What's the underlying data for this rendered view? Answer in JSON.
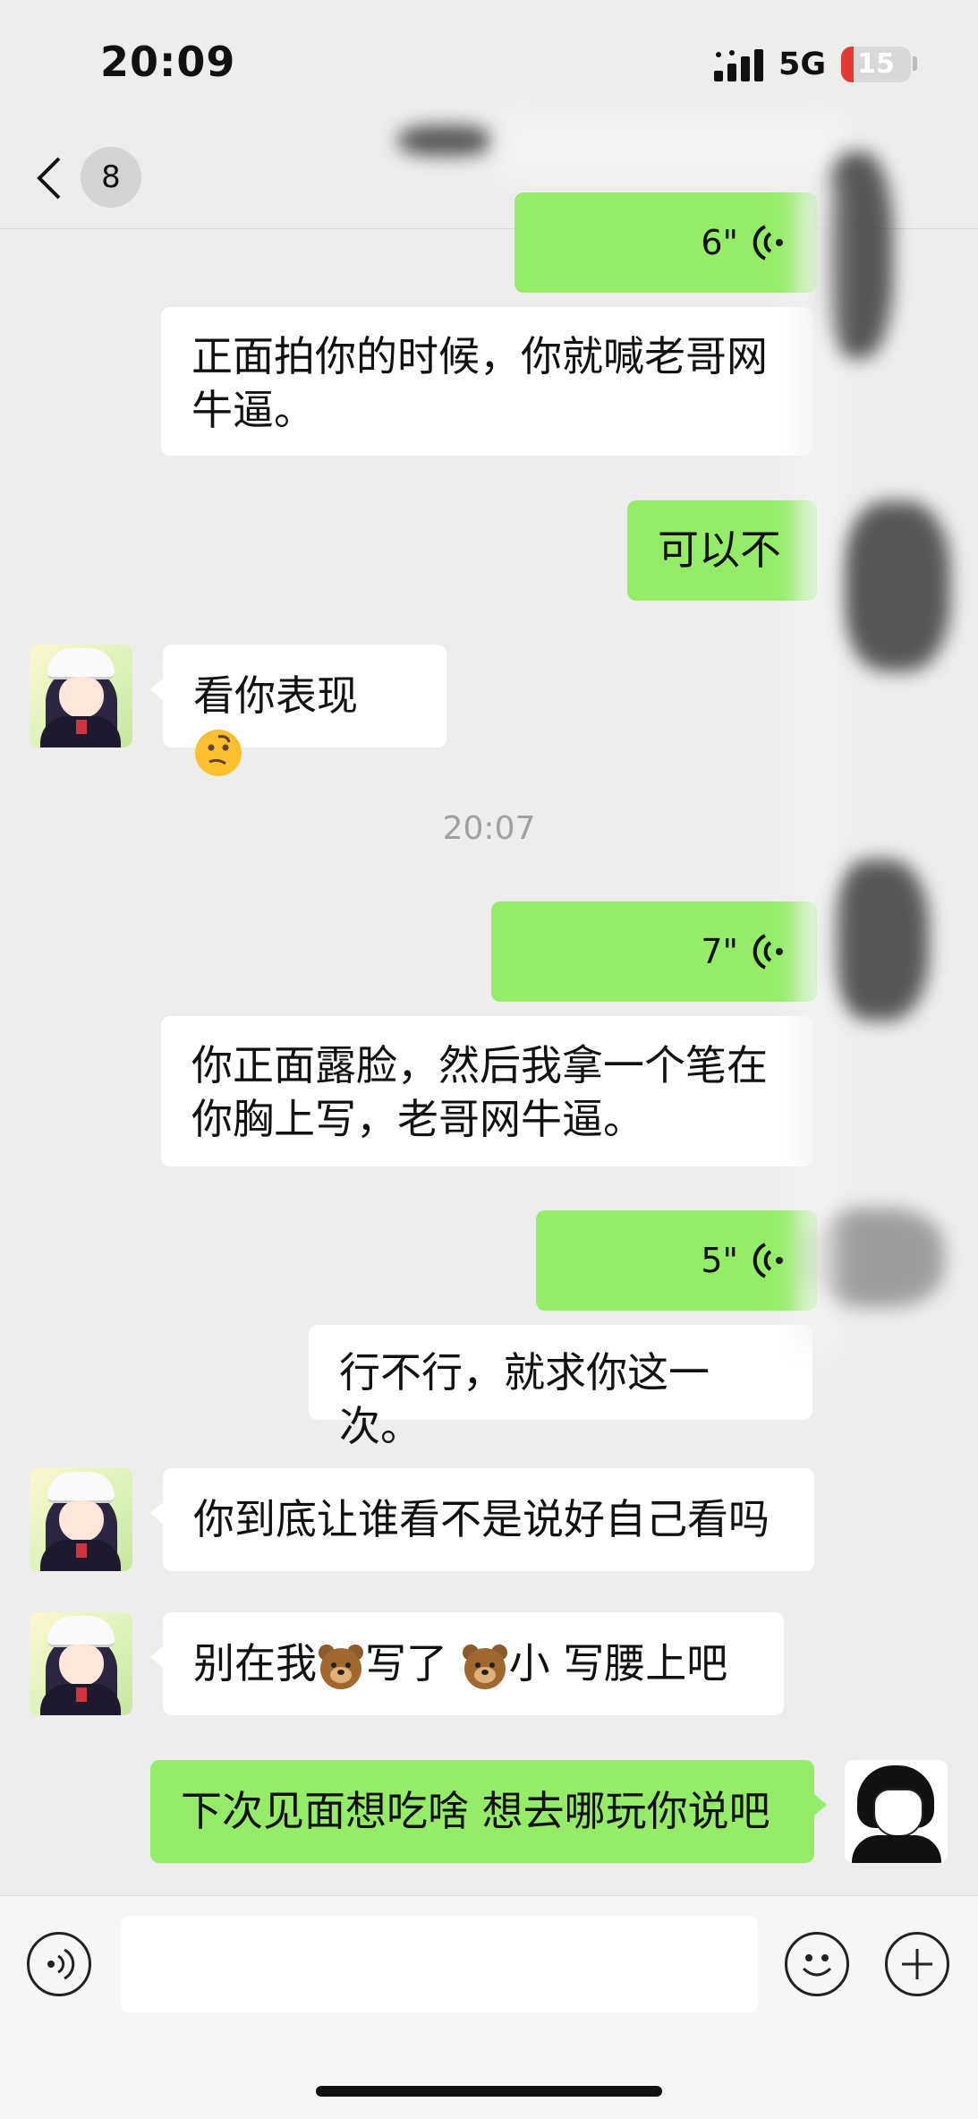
{
  "status_bar": {
    "time": "20:09",
    "network": "5G",
    "battery": "15"
  },
  "header": {
    "unread_count": "8"
  },
  "messages": [
    {
      "type": "voice",
      "direction": "out",
      "duration": "6\""
    },
    {
      "type": "text",
      "direction": "in",
      "text": "正面拍你的时候，你就喊老哥网牛逼。"
    },
    {
      "type": "text",
      "direction": "out",
      "text": "可以不"
    },
    {
      "type": "text",
      "direction": "in",
      "text": "看你表现",
      "emoji": "thinking-face-emoji"
    },
    {
      "type": "timestamp",
      "text": "20:07"
    },
    {
      "type": "voice",
      "direction": "out",
      "duration": "7\""
    },
    {
      "type": "text",
      "direction": "in",
      "text": "你正面露脸，然后我拿一个笔在你胸上写，老哥网牛逼。"
    },
    {
      "type": "voice",
      "direction": "out",
      "duration": "5\""
    },
    {
      "type": "text",
      "direction": "in",
      "text": "行不行，就求你这一次。"
    },
    {
      "type": "text",
      "direction": "in",
      "text": "你到底让谁看不是说好自己看吗"
    },
    {
      "type": "text",
      "direction": "in",
      "segments": [
        "别在我",
        "写了 ",
        "小 写腰上吧"
      ],
      "emoji": "bear-face-emoji"
    },
    {
      "type": "text",
      "direction": "out",
      "text": "下次见面想吃啥 想去哪玩你说吧"
    }
  ],
  "input_bar": {
    "icons": [
      "voice-icon",
      "emoji-icon",
      "plus-icon"
    ]
  },
  "colors": {
    "outgoing_bubble": "#95ec69",
    "incoming_bubble": "#ffffff",
    "background": "#ededed"
  }
}
